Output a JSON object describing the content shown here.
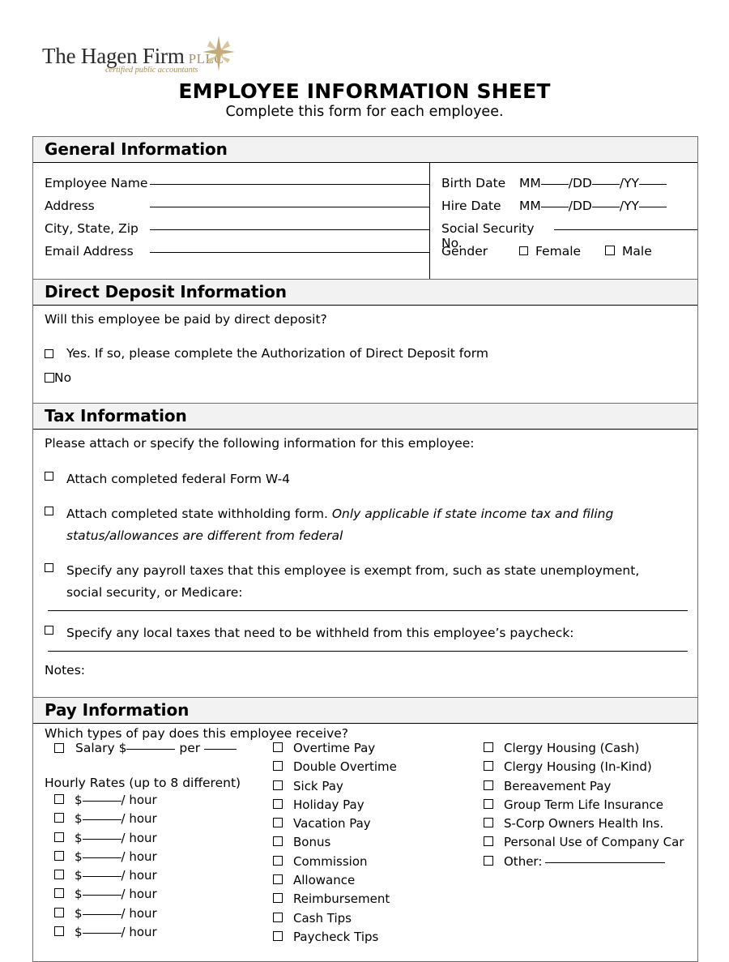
{
  "logo": {
    "name": "The Hagen Firm",
    "suffix": "PLLC",
    "tagline": "certified public accountants",
    "star_color": "#c2ab77",
    "text_color": "#2b2b2b",
    "accent_color": "#a59062"
  },
  "header": {
    "title": "EMPLOYEE INFORMATION SHEET",
    "subtitle": "Complete this form for each employee."
  },
  "general": {
    "heading": "General Information",
    "left_fields": [
      {
        "label": "Employee Name"
      },
      {
        "label": "Address"
      },
      {
        "label": "City, State, Zip"
      },
      {
        "label": "Email Address"
      }
    ],
    "birth_date_label": "Birth Date",
    "hire_date_label": "Hire Date",
    "date_mm": "MM",
    "date_dd": "/DD",
    "date_yy": "/YY",
    "ssn_label": "Social Security No.",
    "gender_label": "Gender",
    "gender_female": "Female",
    "gender_male": "Male"
  },
  "direct_deposit": {
    "heading": "Direct Deposit Information",
    "question": "Will this employee be paid by direct deposit?",
    "options": [
      {
        "label": "Yes.  If so, please complete the Authorization of Direct Deposit form"
      },
      {
        "label": "No"
      }
    ]
  },
  "tax": {
    "heading": "Tax Information",
    "intro": "Please attach or specify the following information for this employee:",
    "item1": "Attach completed federal Form W-4",
    "item2_normal": "Attach completed state withholding form. ",
    "item2_italic": "Only applicable if state income tax and filing status/allowances are different from federal",
    "item3": "Specify any payroll taxes that this employee is exempt from, such as state unemployment, social security, or Medicare:",
    "item4": "Specify any local taxes that need to be withheld from this employee’s paycheck:",
    "notes_label": "Notes:"
  },
  "pay": {
    "heading": "Pay Information",
    "question": "Which types of pay does this employee receive?",
    "salary_label": "Salary $",
    "salary_per": "per",
    "hourly_title": "Hourly Rates (up to 8 different)",
    "hourly_prefix": "$",
    "hourly_suffix": "/ hour",
    "hourly_count": 8,
    "column2": [
      "Overtime Pay",
      "Double Overtime",
      "Sick Pay",
      "Holiday Pay",
      "Vacation Pay",
      "Bonus",
      "Commission",
      "Allowance",
      "Reimbursement",
      "Cash Tips",
      "Paycheck Tips"
    ],
    "column3": [
      "Clergy Housing (Cash)",
      "Clergy Housing (In-Kind)",
      "Bereavement Pay",
      "Group Term Life Insurance",
      "S-Corp Owners Health Ins.",
      "Personal Use of Company Car"
    ],
    "other_label": "Other:"
  },
  "colors": {
    "section_header_bg": "#f2f2f2",
    "border": "#6e6e6e",
    "rule": "#000000"
  }
}
